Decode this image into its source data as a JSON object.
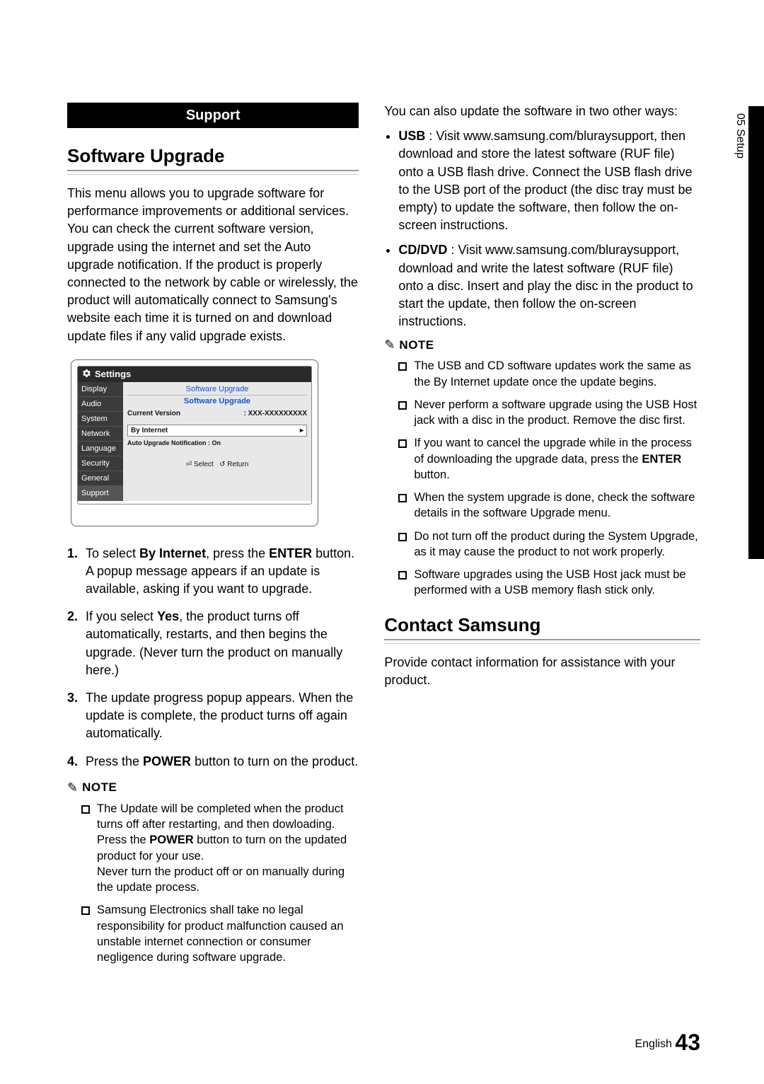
{
  "sideTab": {
    "label": "05 Setup"
  },
  "sectionBar": "Support",
  "heading1": "Software Upgrade",
  "intro": "This menu allows you to upgrade software for performance improvements or additional services. You can check the current software version, upgrade using the internet and set the Auto upgrade notification. If the product is properly connected to the network by cable or wirelessly, the product will automatically connect to Samsung's website each time it is turned on and download update files if any valid upgrade exists.",
  "ui": {
    "settingsLabel": "Settings",
    "nav": [
      "Display",
      "Audio",
      "System",
      "Network",
      "Language",
      "Security",
      "General",
      "Support"
    ],
    "crumb": "Software Upgrade",
    "subTitle": "Software Upgrade",
    "versionLabel": "Current Version",
    "versionValue": ": XXX-XXXXXXXXX",
    "byInternet": "By Internet",
    "autoNotif": "Auto Upgrade Notification : On",
    "footerSelect": "Select",
    "footerReturn": "Return"
  },
  "steps": {
    "s1a": "To select ",
    "s1b": "By Internet",
    "s1c": ", press the ",
    "s1d": "ENTER",
    "s1e": " button.",
    "s1f": "A popup message appears if an update is available, asking if you want to upgrade.",
    "s2a": "If you select ",
    "s2b": "Yes",
    "s2c": ", the product turns off automatically, restarts, and then begins the upgrade. (Never turn the product on manually here.)",
    "s3": "The update progress popup appears. When the update is complete, the product turns off again automatically.",
    "s4a": "Press the ",
    "s4b": "POWER",
    "s4c": " button to turn on the product."
  },
  "noteLabel": "NOTE",
  "notesLeft": {
    "n1a": "The Update will be completed when the product turns off after restarting, and then dowloading. Press the ",
    "n1b": "POWER",
    "n1c": " button to turn on the updated product for your use.",
    "n1d": "Never turn the product off or on manually during the update process.",
    "n2": "Samsung Electronics shall take no legal responsibility for product malfunction caused an unstable internet connection or consumer negligence during software upgrade."
  },
  "rightIntro": "You can also update the software in two other ways:",
  "rightBullets": {
    "usbLabel": "USB",
    "usbText": " : Visit www.samsung.com/bluraysupport, then download and store the latest software (RUF file) onto a USB flash drive. Connect the USB flash drive to the USB port of the product (the disc tray must be empty) to update the software, then follow the on-screen instructions.",
    "cdLabel": "CD/DVD",
    "cdText": " : Visit www.samsung.com/bluraysupport, download and write the latest software (RUF file) onto a disc. Insert and play the disc in the product to start the update, then follow the on-screen instructions."
  },
  "notesRight": {
    "n1": "The USB and CD software updates work the same as the By Internet update once the update begins.",
    "n2": "Never perform a software upgrade using the USB Host jack with a disc in the product. Remove the disc first.",
    "n3a": "If you want to cancel the upgrade while in the process of downloading the upgrade data, press the ",
    "n3b": "ENTER",
    "n3c": " button.",
    "n4": "When the system upgrade is done, check the software details in the software Upgrade menu.",
    "n5": "Do not turn off the product during the System Upgrade, as it may cause the product to not work properly.",
    "n6": "Software upgrades using the USB Host jack must be performed with a USB memory flash stick only."
  },
  "heading2": "Contact Samsung",
  "contactText": "Provide contact information for assistance with your product.",
  "footer": {
    "lang": "English",
    "page": "43"
  }
}
